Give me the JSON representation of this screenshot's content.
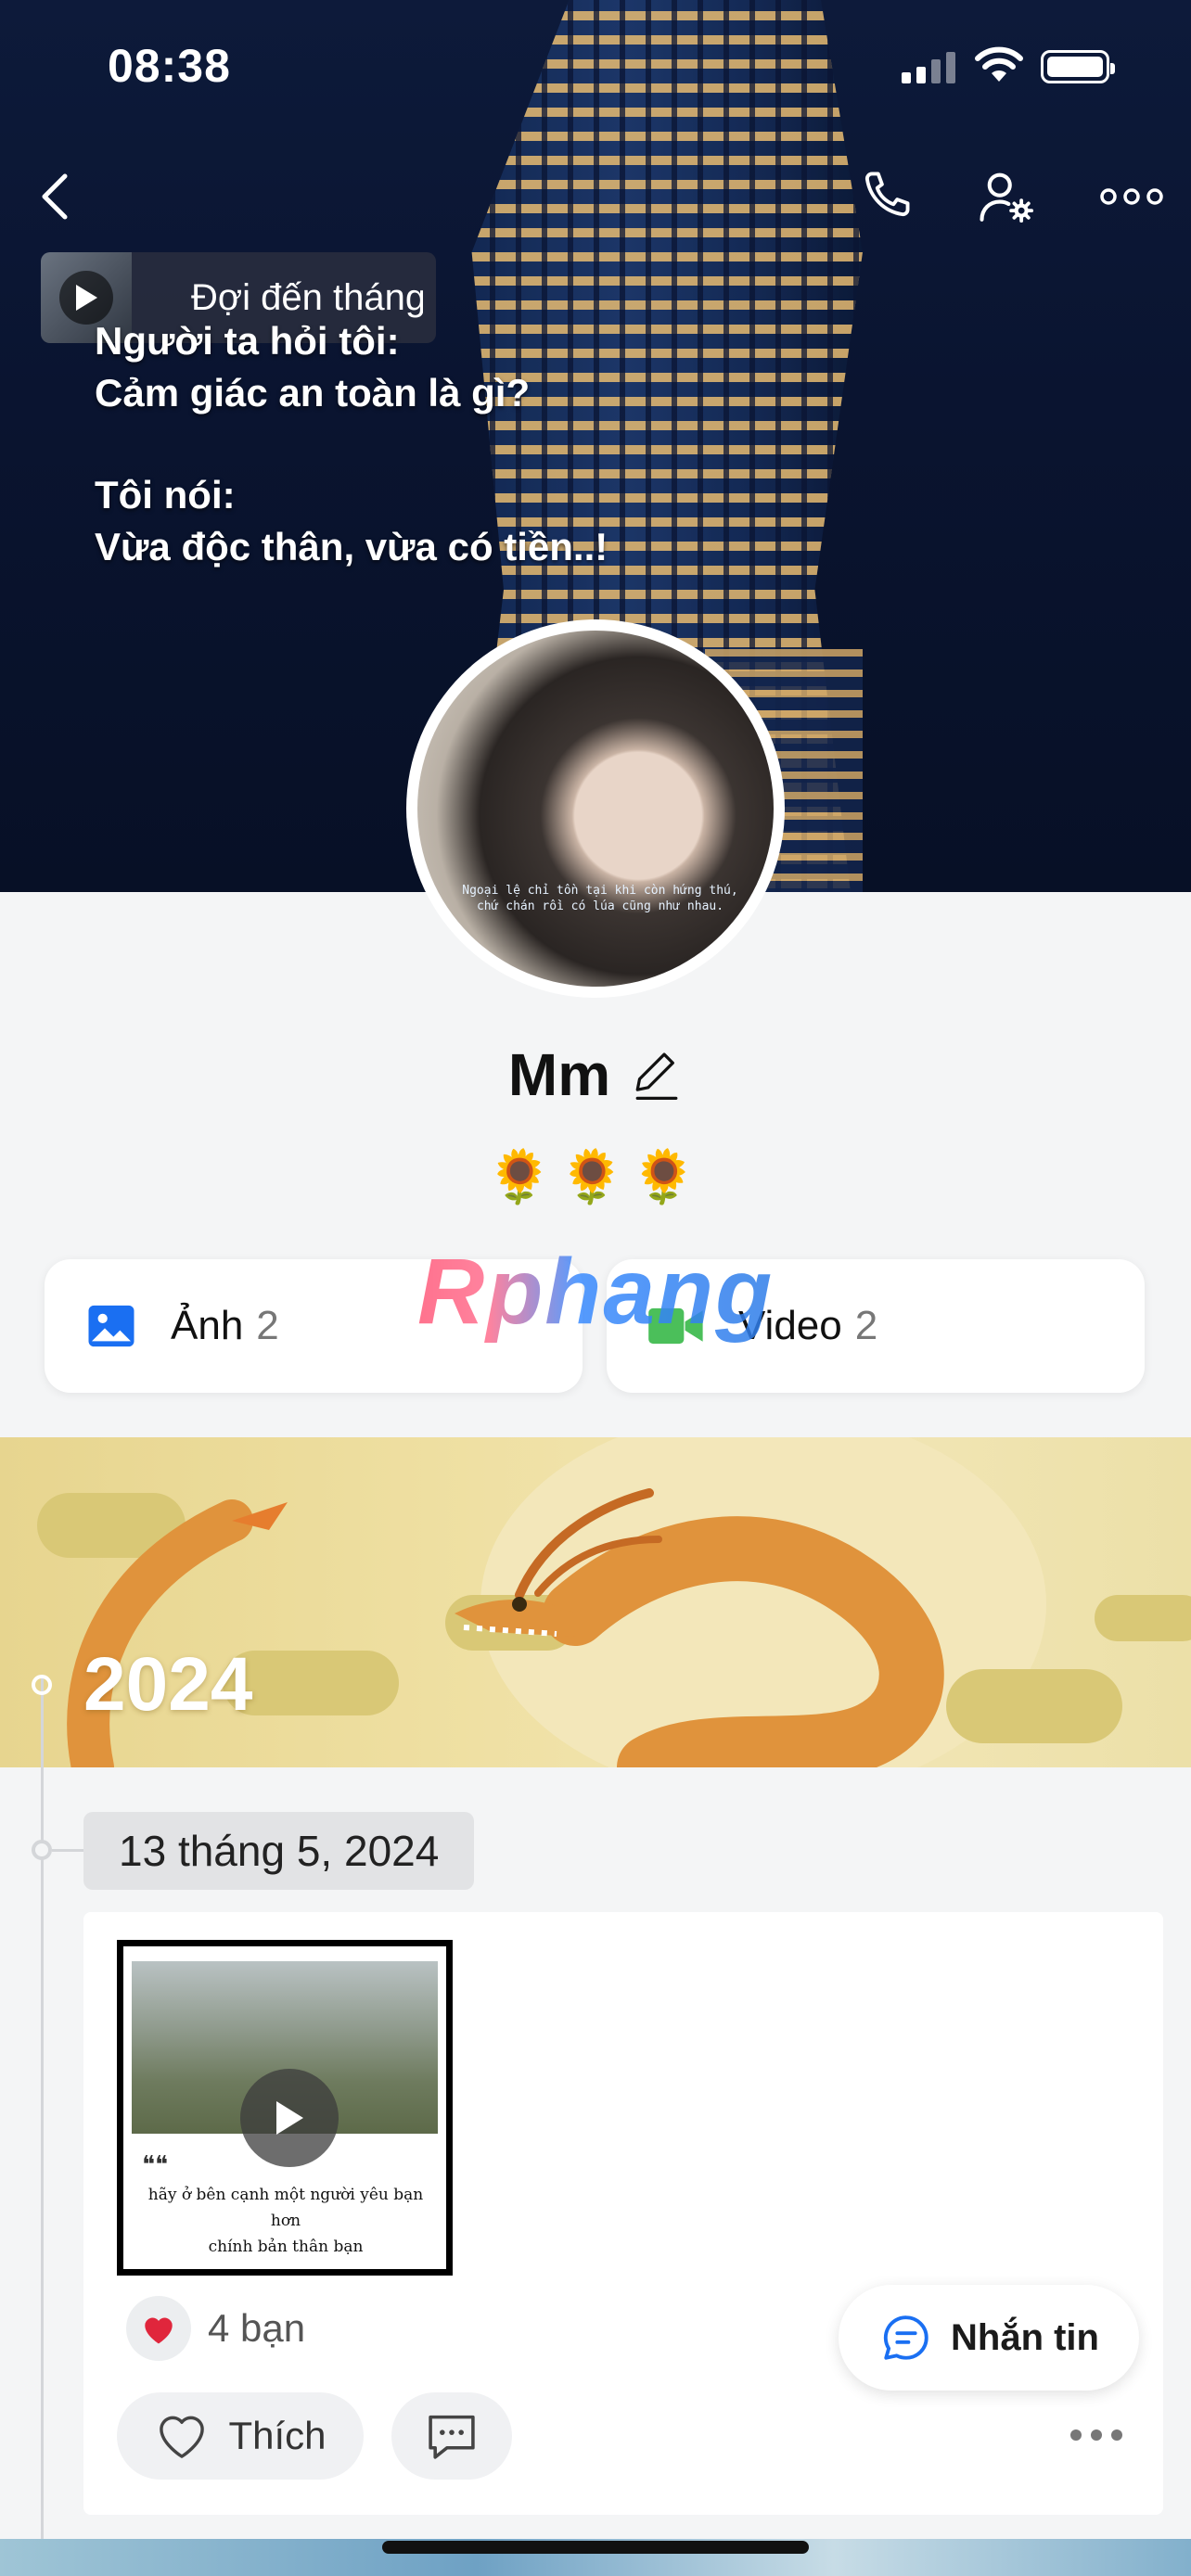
{
  "status_bar": {
    "time": "08:38"
  },
  "cover": {
    "music_title": "Đợi đến tháng",
    "text_lines": [
      "Người ta hỏi tôi:",
      "Cảm giác an toàn là gì?",
      "",
      "Tôi nói:",
      "Vừa độc thân, vừa có tiền..!"
    ],
    "avatar_quote_1": "Ngoại lệ chỉ tồn tại khi còn hứng thú,",
    "avatar_quote_2": "chứ chán rồi có lúa cũng như nhau."
  },
  "profile": {
    "name": "Mm",
    "bio": "🌻🌻🌻"
  },
  "media_tabs": [
    {
      "label": "Ảnh",
      "count": "2",
      "icon": "photo-icon",
      "color": "#1a6ff2"
    },
    {
      "label": "Video",
      "count": "2",
      "icon": "video-camera-icon",
      "color": "#4bbf5a"
    }
  ],
  "watermark": "Rphang",
  "timeline": {
    "year": "2024",
    "date": "13 tháng 5, 2024"
  },
  "post": {
    "caption_line_1": "hãy ở bên cạnh một người yêu bạn hơn",
    "caption_line_2": "chính bản thân bạn",
    "quote_mark": "❝❝",
    "reactions": "4 bạn",
    "like_label": "Thích"
  },
  "message_button": {
    "label": "Nhắn tin"
  },
  "colors": {
    "accent": "#1a6ff2",
    "heart": "#e0263c",
    "background": "#f4f5f6"
  }
}
